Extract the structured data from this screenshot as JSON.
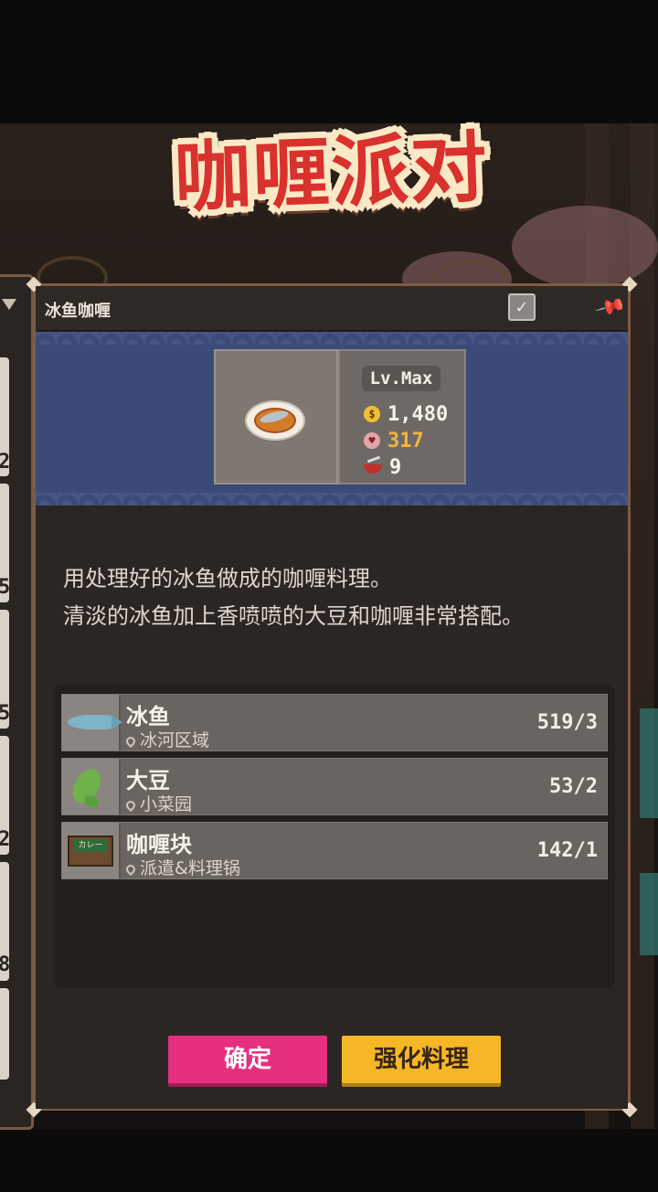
{
  "title": "咖喱派对",
  "left_panel": {
    "numbers": [
      "2",
      "5",
      "5",
      "2",
      "8"
    ]
  },
  "recipe": {
    "name": "冰鱼咖喱",
    "level": "Lv.Max",
    "price": "1,480",
    "hearts": "317",
    "bowls": "9",
    "icon": "fish-curry-plate-icon",
    "description_lines": [
      "用处理好的冰鱼做成的咖喱料理。",
      "清淡的冰鱼加上香喷喷的大豆和咖喱非常搭配。"
    ]
  },
  "ingredients": [
    {
      "name": "冰鱼",
      "location": "冰河区域",
      "count": "519/3",
      "icon": "ice-fish-icon"
    },
    {
      "name": "大豆",
      "location": "小菜园",
      "count": "53/2",
      "icon": "soybean-icon"
    },
    {
      "name": "咖喱块",
      "location": "派遣&料理锅",
      "count": "142/1",
      "icon": "curry-block-icon",
      "icon_text": "カレー"
    }
  ],
  "buttons": {
    "confirm": "确定",
    "enhance": "强化料理"
  },
  "icons": {
    "check": "✓",
    "pin": "📌",
    "coin": "$",
    "heart": "♥"
  },
  "colors": {
    "confirm": "#e62f7e",
    "enhance": "#f5b727",
    "banner": "#3b4a77",
    "title": "#d9312d"
  }
}
